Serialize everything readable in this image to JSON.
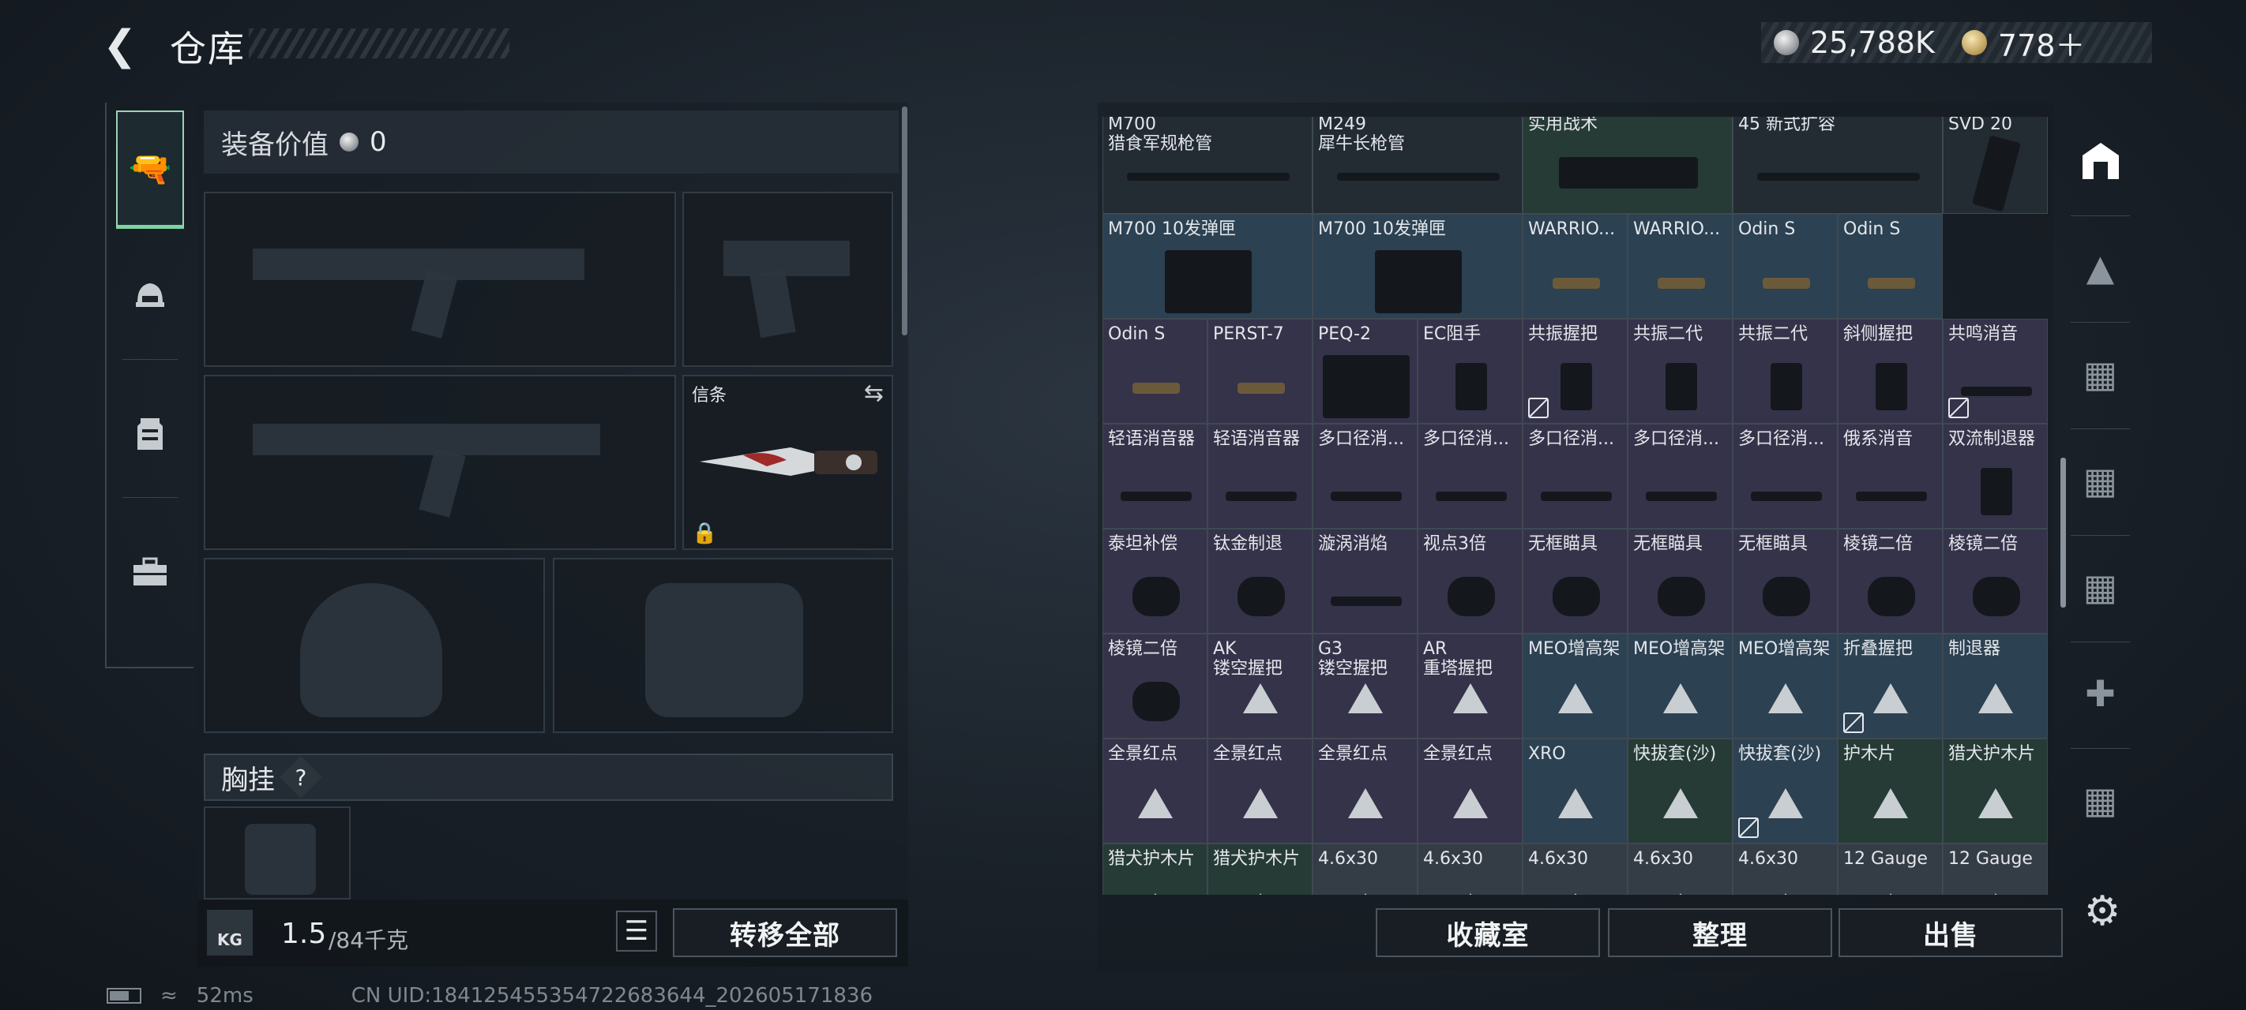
{
  "header": {
    "title": "仓库",
    "currencies": [
      {
        "icon": "silver-coin-icon",
        "value": "25,788K"
      },
      {
        "icon": "gold-coin-icon",
        "value": "778＋"
      }
    ]
  },
  "equipment": {
    "value_label": "装备价值",
    "value": "0",
    "melee_label": "信条",
    "chest_label": "胸挂",
    "chest_help": "?"
  },
  "bottom_left": {
    "weight": "1.5",
    "weight_cap": "/84千克",
    "kg_label": "KG",
    "transfer_all": "转移全部"
  },
  "bottom_right": {
    "collection": "收藏室",
    "arrange": "整理",
    "sell": "出售"
  },
  "stash_rows": [
    [
      "M700\n猎食军规枪管",
      "M249\n犀牛长枪管",
      "实用战术",
      "45 新式扩容",
      "SVD 20"
    ],
    [
      "M700 10发弹匣",
      "M700 10发弹匣",
      "WARRIO...",
      "WARRIO...",
      "Odin S",
      "Odin S"
    ],
    [
      "Odin S",
      "PERST-7",
      "PEQ-2",
      "EC阻手",
      "共振握把",
      "共振二代",
      "共振二代",
      "斜侧握把",
      "共鸣消音"
    ],
    [
      "轻语消音器",
      "轻语消音器",
      "多口径消...",
      "多口径消...",
      "多口径消...",
      "多口径消...",
      "多口径消...",
      "俄系消音",
      "双流制退器"
    ],
    [
      "泰坦补偿",
      "钛金制退",
      "漩涡消焰",
      "视点3倍",
      "无框瞄具",
      "无框瞄具",
      "无框瞄具",
      "棱镜二倍",
      "棱镜二倍"
    ],
    [
      "棱镜二倍",
      "AK\n镂空握把",
      "G3\n镂空握把",
      "AR\n重塔握把",
      "MEO增高架",
      "MEO增高架",
      "MEO增高架",
      "折叠握把",
      "制退器"
    ],
    [
      "全景红点",
      "全景红点",
      "全景红点",
      "全景红点",
      "XRO",
      "快拔套(沙)",
      "快拔套(沙)",
      "护木片",
      "猎犬护木片"
    ],
    [
      "猎犬护木片",
      "猎犬护木片",
      "4.6x30",
      "4.6x30",
      "4.6x30",
      "4.6x30",
      "4.6x30",
      "12 Gauge",
      "12 Gauge"
    ]
  ],
  "status": {
    "ping": "52ms",
    "uid": "CN UID:18412545535472​2683644_202605171836"
  }
}
